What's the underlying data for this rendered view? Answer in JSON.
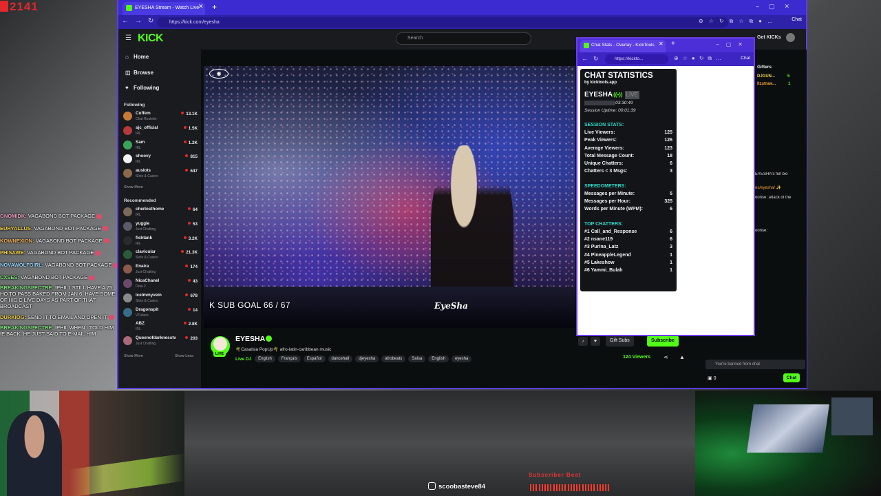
{
  "stream_counter": "2141",
  "overlay_chat": [
    {
      "user": "GNOMIDK:",
      "text": "VAGABOND BOT PACKAGE",
      "color": "#f2a2c2"
    },
    {
      "user": "EURYALLUS:",
      "text": "VAGABOND BOT PACKAGE",
      "color": "#f3d04a"
    },
    {
      "user": "KOWNEXION:",
      "text": "VAGABOND BOT PACKAGE",
      "color": "#f0b25a"
    },
    {
      "user": "PHISAWE:",
      "text": "VAGABOND BOT PACKAGE",
      "color": "#f3d04a"
    },
    {
      "user": "NOVAWOLFGIRL:",
      "text": "VAGABOND BOT PACKAGE",
      "color": "#9bd8ff"
    },
    {
      "user": "CXSES:",
      "text": "VAGABOND BOT PACKAGE",
      "color": "#7de07a"
    },
    {
      "user": "BREAKINGSPECTRE:",
      "text": "!PHIL I STILL HAVE A 75 HO TO PASS BAKED FROM JAN 6. HAVE SOME OF HIS C LIVE DAYS AS PART OF THAT BROADCAST",
      "color": "#7de07a"
    },
    {
      "user": "DURKIOG:",
      "text": "SEND IT TO EMAIL AND OPEN IT",
      "color": "#f3d04a"
    },
    {
      "user": "BREAKINGSPECTRE:",
      "text": "!PHIL WHEN I TOLD HIM IE BACK, HE JUST SAID TO E-MAIL HIM",
      "color": "#7de07a"
    }
  ],
  "browser": {
    "tab_title": "EYESHA Stream - Watch Live",
    "url": "https://kick.com/eyesha",
    "chat_button": "Chat"
  },
  "kick": {
    "logo": "KICK",
    "search_placeholder": "Search",
    "get_kicks": "Get KICKs",
    "nav": [
      {
        "label": "Home",
        "icon": "home-icon",
        "glyph": "⌂"
      },
      {
        "label": "Browse",
        "icon": "browse-icon",
        "glyph": "◫"
      },
      {
        "label": "Following",
        "icon": "heart-icon",
        "glyph": "♥"
      }
    ],
    "following_title": "Following",
    "following": [
      {
        "name": "Cuffem",
        "category": "Chat Roulette",
        "viewers": "13.1K",
        "color": "#c77b3a"
      },
      {
        "name": "sjc_official",
        "category": "IRL",
        "viewers": "1.5K",
        "color": "#b53a3a"
      },
      {
        "name": "Sam",
        "category": "IRL",
        "viewers": "1.2K",
        "color": "#3aa55a"
      },
      {
        "name": "shoovy",
        "category": "IRL",
        "viewers": "815",
        "color": "#f2f2f2"
      },
      {
        "name": "auslots",
        "category": "Slots & Casino",
        "viewers": "647",
        "color": "#8a6a4a"
      }
    ],
    "show_more_1": "Show More",
    "recommended_title": "Recommended",
    "recommended": [
      {
        "name": "cherlosthome",
        "category": "IRL",
        "viewers": "64",
        "color": "#7a6a5a"
      },
      {
        "name": "yuggie",
        "category": "Just Chatting",
        "viewers": "53",
        "color": "#5a5a6a"
      },
      {
        "name": "fishtank",
        "category": "IRL",
        "viewers": "3.2K",
        "color": "#2a2a2a"
      },
      {
        "name": "clavicular",
        "category": "Slots & Casino",
        "viewers": "21.3K",
        "color": "#2a5a3a"
      },
      {
        "name": "Enaira",
        "category": "Just Chatting",
        "viewers": "174",
        "color": "#8a5a4a"
      },
      {
        "name": "NicaChanel",
        "category": "Dota 2",
        "viewers": "43",
        "color": "#6a4a6a"
      },
      {
        "name": "icelmmyvein",
        "category": "Slots & Casino",
        "viewers": "678",
        "color": "#8a8a8a"
      },
      {
        "name": "Dragonspit",
        "category": "VTubers",
        "viewers": "14",
        "color": "#3a6a8a"
      },
      {
        "name": "ABZ",
        "category": "IRL",
        "viewers": "2.8K",
        "color": "#1a1a1a"
      },
      {
        "name": "Queenofdarknesstv",
        "category": "Just Chatting",
        "viewers": "203",
        "color": "#aa6a7a"
      }
    ],
    "show_more_2": "Show More",
    "show_less": "Show Less"
  },
  "video": {
    "sub_goal": "K SUB GOAL  66 / 67",
    "watermark": "EyeSha"
  },
  "stream_info": {
    "live_badge": "LIVE",
    "streamer": "EYESHA",
    "title": "🌴Casalsia PopUp🌴 afro-latin-caribbean music",
    "category": "Live DJ",
    "tags": [
      "English",
      "Français",
      "Español",
      "dancehall",
      "djeyesha",
      "afrobeats",
      "Salsa",
      "English",
      "eyesha"
    ],
    "gift_subs": "Gift Subs",
    "subscribe": "Subscribe",
    "viewers": "124",
    "viewers_label": "Viewers"
  },
  "chat_column": {
    "gifters_title": "Gifters",
    "gifters": [
      {
        "name": "DJGUN...",
        "count": "5",
        "color": "#f0d050"
      },
      {
        "name": "itzstraw...",
        "count": "1",
        "color": "#f0a030"
      }
    ],
    "snippets": [
      {
        "text": "EYESHA's full bio",
        "orange": false
      },
      {
        "text": "es/eyesha/ ✨",
        "orange": true
      },
      {
        "text": "oonse: attack of the",
        "orange": false
      },
      {
        "text": "oonse:",
        "orange": false
      }
    ],
    "banned_text": "You're banned from chat",
    "kicks_count": "0",
    "chat_button": "Chat"
  },
  "popup": {
    "tab_title": "Chat Stats - Overlay - KickTools",
    "url": "https://kickto...",
    "chat_button": "Chat",
    "stats": {
      "title": "CHAT STATISTICS",
      "by": "by kicktools.app",
      "channel": "EYESHA",
      "live_label": "LIVE",
      "stream_uptime_label": "Stream Uptime:",
      "stream_uptime": "03:30:49",
      "session_uptime": "Session Uptime: 00:01:39",
      "session_head": "SESSION STATS:",
      "session": [
        {
          "label": "Live Viewers:",
          "value": "125"
        },
        {
          "label": "Peak Viewers:",
          "value": "126"
        },
        {
          "label": "Average Viewers:",
          "value": "123"
        },
        {
          "label": "Total Message Count:",
          "value": "18"
        },
        {
          "label": "Unique Chatters:",
          "value": "6"
        },
        {
          "label": "Chatters < 3 Msgs:",
          "value": "3"
        }
      ],
      "speed_head": "SPEEDOMETERS:",
      "speed": [
        {
          "label": "Messages per Minute:",
          "value": "5"
        },
        {
          "label": "Messages per Hour:",
          "value": "325"
        },
        {
          "label": "Words per Minute (WPM):",
          "value": "6"
        }
      ],
      "top_head": "TOP CHATTERS:",
      "top": [
        {
          "label": "#1 Call_and_Response",
          "value": "6"
        },
        {
          "label": "#2 nsane119",
          "value": "6"
        },
        {
          "label": "#3 Purina_Latz",
          "value": "3"
        },
        {
          "label": "#4 PineappleLegend",
          "value": "1"
        },
        {
          "label": "#5 Lakeshow",
          "value": "1"
        },
        {
          "label": "#6 Yammi_Bulah",
          "value": "1"
        }
      ]
    }
  },
  "overlay_bottom": {
    "instagram": "scoobasteve84",
    "sub_beat": "Subscriber Beat"
  }
}
